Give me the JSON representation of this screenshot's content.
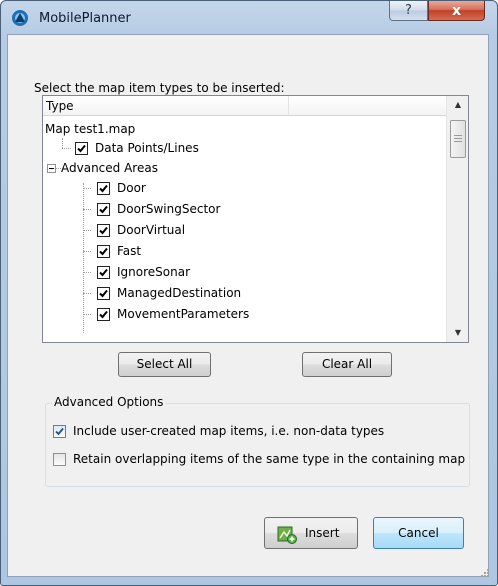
{
  "window": {
    "title": "MobilePlanner",
    "help_button": "?",
    "close_button": "x"
  },
  "prompt": "Select the map item types to be inserted:",
  "tree": {
    "column_header": "Type",
    "root": "Map test1.map",
    "items": [
      {
        "label": "Data Points/Lines",
        "checked": true
      },
      {
        "label": "Advanced Areas",
        "expanded": true
      },
      {
        "label": "Door",
        "checked": true
      },
      {
        "label": "DoorSwingSector",
        "checked": true
      },
      {
        "label": "DoorVirtual",
        "checked": true
      },
      {
        "label": "Fast",
        "checked": true
      },
      {
        "label": "IgnoreSonar",
        "checked": true
      },
      {
        "label": "ManagedDestination",
        "checked": true
      },
      {
        "label": "MovementParameters",
        "checked": true
      }
    ]
  },
  "buttons": {
    "select_all": "Select All",
    "clear_all": "Clear All",
    "insert": "Insert",
    "cancel": "Cancel"
  },
  "advanced": {
    "title": "Advanced Options",
    "options": [
      {
        "label": "Include user-created map items, i.e. non-data types",
        "checked": true
      },
      {
        "label": "Retain overlapping items of the same type in the containing map",
        "checked": false
      }
    ]
  }
}
